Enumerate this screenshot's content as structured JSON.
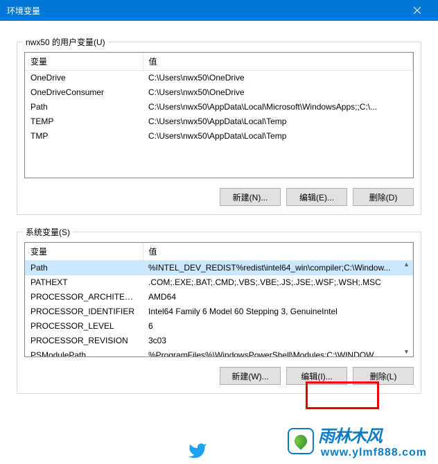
{
  "window": {
    "title": "环境变量"
  },
  "user_section": {
    "label": "nwx50 的用户变量(U)",
    "headers": {
      "var": "变量",
      "val": "值"
    },
    "rows": [
      {
        "var": "OneDrive",
        "val": "C:\\Users\\nwx50\\OneDrive"
      },
      {
        "var": "OneDriveConsumer",
        "val": "C:\\Users\\nwx50\\OneDrive"
      },
      {
        "var": "Path",
        "val": "C:\\Users\\nwx50\\AppData\\Local\\Microsoft\\WindowsApps;;C:\\..."
      },
      {
        "var": "TEMP",
        "val": "C:\\Users\\nwx50\\AppData\\Local\\Temp"
      },
      {
        "var": "TMP",
        "val": "C:\\Users\\nwx50\\AppData\\Local\\Temp"
      }
    ],
    "buttons": {
      "new": "新建(N)...",
      "edit": "编辑(E)...",
      "delete": "删除(D)"
    }
  },
  "system_section": {
    "label": "系统变量(S)",
    "headers": {
      "var": "变量",
      "val": "值"
    },
    "rows": [
      {
        "var": "Path",
        "val": "%INTEL_DEV_REDIST%redist\\intel64_win\\compiler;C:\\Window..."
      },
      {
        "var": "PATHEXT",
        "val": ".COM;.EXE;.BAT;.CMD;.VBS;.VBE;.JS;.JSE;.WSF;.WSH;.MSC"
      },
      {
        "var": "PROCESSOR_ARCHITECT...",
        "val": "AMD64"
      },
      {
        "var": "PROCESSOR_IDENTIFIER",
        "val": "Intel64 Family 6 Model 60 Stepping 3, GenuineIntel"
      },
      {
        "var": "PROCESSOR_LEVEL",
        "val": "6"
      },
      {
        "var": "PROCESSOR_REVISION",
        "val": "3c03"
      },
      {
        "var": "PSModulePath",
        "val": "%ProgramFiles%\\WindowsPowerShell\\Modules;C:\\WINDOW..."
      }
    ],
    "buttons": {
      "new": "新建(W)...",
      "edit": "编辑(I)...",
      "delete": "删除(L)"
    }
  },
  "watermark": {
    "brand": "雨林木风",
    "url": "www.ylmf888.com"
  }
}
